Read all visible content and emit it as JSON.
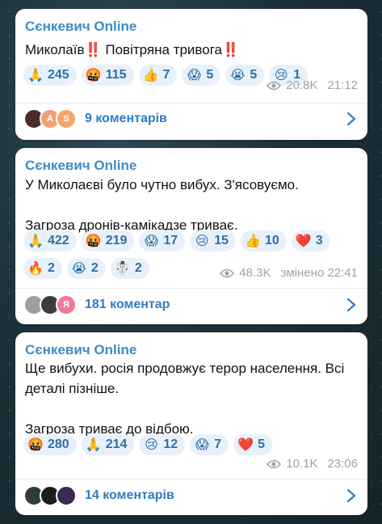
{
  "messages": [
    {
      "author": "Сєнкевич Online",
      "text": "Миколаїв‼️ Повітряна тривога‼️",
      "reactions": [
        {
          "emoji": "🙏",
          "count": "245",
          "icon": "pray-icon"
        },
        {
          "emoji": "🤬",
          "count": "115",
          "icon": "angry-icon"
        },
        {
          "emoji": "👍",
          "count": "7",
          "icon": "thumbs-up-icon"
        },
        {
          "emoji": "😱",
          "count": "5",
          "icon": "scream-icon"
        },
        {
          "emoji": "😭",
          "count": "5",
          "icon": "sob-icon"
        },
        {
          "emoji": "😢",
          "count": "1",
          "icon": "cry-icon"
        }
      ],
      "views": "20.8K",
      "time": "21:12",
      "comments_label": "9 коментарів",
      "avatars": [
        {
          "letter": "",
          "color": "#4a2a2a"
        },
        {
          "letter": "A",
          "color": "#f0a07a"
        },
        {
          "letter": "S",
          "color": "#f5a66b"
        }
      ]
    },
    {
      "author": "Сєнкевич Online",
      "text": "У Миколаєві було чутно вибух. З'ясовуємо.\n\nЗагроза дронів-камікадзе триває.",
      "reactions": [
        {
          "emoji": "🙏",
          "count": "422",
          "icon": "pray-icon"
        },
        {
          "emoji": "🤬",
          "count": "219",
          "icon": "angry-icon"
        },
        {
          "emoji": "😱",
          "count": "17",
          "icon": "scream-icon"
        },
        {
          "emoji": "😢",
          "count": "15",
          "icon": "cry-icon"
        },
        {
          "emoji": "👍",
          "count": "10",
          "icon": "thumbs-up-icon"
        },
        {
          "emoji": "❤️",
          "count": "3",
          "icon": "heart-icon"
        },
        {
          "emoji": "🔥",
          "count": "2",
          "icon": "fire-icon"
        },
        {
          "emoji": "😭",
          "count": "2",
          "icon": "sob-icon"
        },
        {
          "emoji": "☃️",
          "count": "2",
          "icon": "snowman-icon"
        }
      ],
      "views": "48.3K",
      "time": "змінено 22:41",
      "comments_label": "181 коментар",
      "avatars": [
        {
          "letter": "",
          "color": "#9aa0a6"
        },
        {
          "letter": "",
          "color": "#3c3c3c"
        },
        {
          "letter": "Я",
          "color": "#f07a9a"
        }
      ]
    },
    {
      "author": "Сєнкевич Online",
      "text": "Ще вибухи. росія продовжує терор населення. Всі деталі пізніше.\n\nЗагроза триває до відбою.",
      "reactions": [
        {
          "emoji": "🤬",
          "count": "280",
          "icon": "angry-icon"
        },
        {
          "emoji": "🙏",
          "count": "214",
          "icon": "pray-icon"
        },
        {
          "emoji": "😢",
          "count": "12",
          "icon": "cry-icon"
        },
        {
          "emoji": "😱",
          "count": "7",
          "icon": "scream-icon"
        },
        {
          "emoji": "❤️",
          "count": "5",
          "icon": "heart-icon"
        }
      ],
      "views": "10.1K",
      "time": "23:06",
      "comments_label": "14 коментарів",
      "avatars": [
        {
          "letter": "",
          "color": "#2e3b3f"
        },
        {
          "letter": "",
          "color": "#1e1e1e"
        },
        {
          "letter": "",
          "color": "#3a2a55"
        }
      ]
    }
  ],
  "colors": {
    "author": "#3f8cc4",
    "chip_bg": "#e8f1fa",
    "chip_text": "#2f6fa7",
    "link": "#2f7cc0",
    "meta": "#9aa4ad"
  }
}
